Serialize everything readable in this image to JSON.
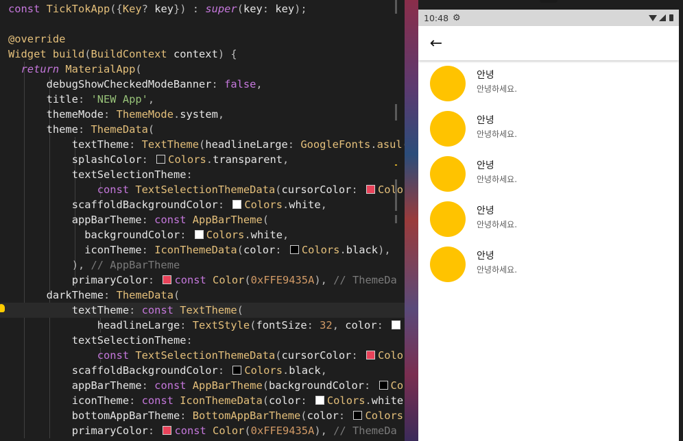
{
  "editor": {
    "lines": [
      [
        [
          "t-kw",
          "const "
        ],
        [
          "t-cls",
          "TickTokApp"
        ],
        [
          "t-pun",
          "({"
        ],
        [
          "t-cls",
          "Key"
        ],
        [
          "t-pun",
          "? "
        ],
        [
          "t-id",
          "key"
        ],
        [
          "t-pun",
          "}) : "
        ],
        [
          "t-kwi",
          "super"
        ],
        [
          "t-pun",
          "("
        ],
        [
          "t-id",
          "key"
        ],
        [
          "t-pun",
          ": "
        ],
        [
          "t-id",
          "key"
        ],
        [
          "t-pun",
          ");"
        ]
      ],
      [],
      [
        [
          "t-ann",
          "@override"
        ]
      ],
      [
        [
          "t-cls",
          "Widget "
        ],
        [
          "t-fn",
          "build"
        ],
        [
          "t-pun",
          "("
        ],
        [
          "t-cls",
          "BuildContext "
        ],
        [
          "t-id",
          "context"
        ],
        [
          "t-pun",
          ") {"
        ]
      ],
      [
        [
          "t-kwi",
          "return "
        ],
        [
          "t-cls",
          "MaterialApp"
        ],
        [
          "t-pun",
          "("
        ]
      ],
      [
        [
          "t-id",
          "debugShowCheckedModeBanner"
        ],
        [
          "t-pun",
          ": "
        ],
        [
          "t-kw",
          "false"
        ],
        [
          "t-pun",
          ","
        ]
      ],
      [
        [
          "t-id",
          "title"
        ],
        [
          "t-pun",
          ": "
        ],
        [
          "t-str",
          "'NEW App'"
        ],
        [
          "t-pun",
          ","
        ]
      ],
      [
        [
          "t-id",
          "themeMode"
        ],
        [
          "t-pun",
          ": "
        ],
        [
          "t-cls",
          "ThemeMode"
        ],
        [
          "t-pun",
          "."
        ],
        [
          "t-id",
          "system"
        ],
        [
          "t-pun",
          ","
        ]
      ],
      [
        [
          "t-id",
          "theme"
        ],
        [
          "t-pun",
          ": "
        ],
        [
          "t-cls",
          "ThemeData"
        ],
        [
          "t-pun",
          "("
        ]
      ],
      [
        [
          "t-id",
          "textTheme"
        ],
        [
          "t-pun",
          ": "
        ],
        [
          "t-cls",
          "TextTheme"
        ],
        [
          "t-pun",
          "("
        ],
        [
          "t-id",
          "headlineLarge"
        ],
        [
          "t-pun",
          ": "
        ],
        [
          "t-cls",
          "GoogleFonts"
        ],
        [
          "t-pun",
          "."
        ],
        [
          "t-fn",
          "asul("
        ]
      ],
      [
        [
          "t-id",
          "splashColor"
        ],
        [
          "t-pun",
          ": "
        ],
        [
          "sw",
          "transparent"
        ],
        [
          "t-cls",
          "Colors"
        ],
        [
          "t-pun",
          "."
        ],
        [
          "t-id",
          "transparent"
        ],
        [
          "t-pun",
          ","
        ]
      ],
      [
        [
          "t-id",
          "textSelectionTheme"
        ],
        [
          "t-pun",
          ":"
        ]
      ],
      [
        [
          "t-kw",
          "const "
        ],
        [
          "t-cls",
          "TextSelectionThemeData"
        ],
        [
          "t-pun",
          "("
        ],
        [
          "t-id",
          "cursorColor"
        ],
        [
          "t-pun",
          ": "
        ],
        [
          "sw",
          "pink"
        ],
        [
          "t-cls",
          "Colo"
        ]
      ],
      [
        [
          "t-id",
          "scaffoldBackgroundColor"
        ],
        [
          "t-pun",
          ": "
        ],
        [
          "sw",
          "white"
        ],
        [
          "t-cls",
          "Colors"
        ],
        [
          "t-pun",
          "."
        ],
        [
          "t-id",
          "white"
        ],
        [
          "t-pun",
          ","
        ]
      ],
      [
        [
          "t-id",
          "appBarTheme"
        ],
        [
          "t-pun",
          ": "
        ],
        [
          "t-kw",
          "const "
        ],
        [
          "t-cls",
          "AppBarTheme"
        ],
        [
          "t-pun",
          "("
        ]
      ],
      [
        [
          "t-id",
          "backgroundColor"
        ],
        [
          "t-pun",
          ": "
        ],
        [
          "sw",
          "white"
        ],
        [
          "t-cls",
          "Colors"
        ],
        [
          "t-pun",
          "."
        ],
        [
          "t-id",
          "white"
        ],
        [
          "t-pun",
          ","
        ]
      ],
      [
        [
          "t-id",
          "iconTheme"
        ],
        [
          "t-pun",
          ": "
        ],
        [
          "t-cls",
          "IconThemeData"
        ],
        [
          "t-pun",
          "("
        ],
        [
          "t-id",
          "color"
        ],
        [
          "t-pun",
          ": "
        ],
        [
          "sw",
          "black"
        ],
        [
          "t-cls",
          "Colors"
        ],
        [
          "t-pun",
          "."
        ],
        [
          "t-id",
          "black"
        ],
        [
          "t-pun",
          "),"
        ]
      ],
      [
        [
          "t-pun",
          "), "
        ],
        [
          "t-cmt",
          "// AppBarTheme"
        ]
      ],
      [
        [
          "t-id",
          "primaryColor"
        ],
        [
          "t-pun",
          ": "
        ],
        [
          "sw",
          "pink"
        ],
        [
          "t-kw",
          "const "
        ],
        [
          "t-cls",
          "Color"
        ],
        [
          "t-pun",
          "("
        ],
        [
          "t-num",
          "0xFFE9435A"
        ],
        [
          "t-pun",
          "), "
        ],
        [
          "t-cmt",
          "// ThemeDa"
        ]
      ],
      [
        [
          "t-id",
          "darkTheme"
        ],
        [
          "t-pun",
          ": "
        ],
        [
          "t-cls",
          "ThemeData"
        ],
        [
          "t-pun",
          "("
        ]
      ],
      [
        [
          "t-id",
          "textTheme"
        ],
        [
          "t-pun",
          ": "
        ],
        [
          "t-kw",
          "const "
        ],
        [
          "t-cls",
          "TextTheme"
        ],
        [
          "t-pun",
          "("
        ]
      ],
      [
        [
          "t-id",
          "headlineLarge"
        ],
        [
          "t-pun",
          ": "
        ],
        [
          "t-cls",
          "TextStyle"
        ],
        [
          "t-pun",
          "("
        ],
        [
          "t-id",
          "fontSize"
        ],
        [
          "t-pun",
          ": "
        ],
        [
          "t-num",
          "32"
        ],
        [
          "t-pun",
          ", "
        ],
        [
          "t-id",
          "color"
        ],
        [
          "t-pun",
          ": "
        ],
        [
          "sw",
          "white"
        ]
      ],
      [
        [
          "t-id",
          "textSelectionTheme"
        ],
        [
          "t-pun",
          ":"
        ]
      ],
      [
        [
          "t-kw",
          "const "
        ],
        [
          "t-cls",
          "TextSelectionThemeData"
        ],
        [
          "t-pun",
          "("
        ],
        [
          "t-id",
          "cursorColor"
        ],
        [
          "t-pun",
          ": "
        ],
        [
          "sw",
          "pink"
        ],
        [
          "t-cls",
          "Colo"
        ]
      ],
      [
        [
          "t-id",
          "scaffoldBackgroundColor"
        ],
        [
          "t-pun",
          ": "
        ],
        [
          "sw",
          "black"
        ],
        [
          "t-cls",
          "Colors"
        ],
        [
          "t-pun",
          "."
        ],
        [
          "t-id",
          "black"
        ],
        [
          "t-pun",
          ","
        ]
      ],
      [
        [
          "t-id",
          "appBarTheme"
        ],
        [
          "t-pun",
          ": "
        ],
        [
          "t-kw",
          "const "
        ],
        [
          "t-cls",
          "AppBarTheme"
        ],
        [
          "t-pun",
          "("
        ],
        [
          "t-id",
          "backgroundColor"
        ],
        [
          "t-pun",
          ": "
        ],
        [
          "sw",
          "black"
        ],
        [
          "t-cls",
          "Co"
        ]
      ],
      [
        [
          "t-id",
          "iconTheme"
        ],
        [
          "t-pun",
          ": "
        ],
        [
          "t-kw",
          "const "
        ],
        [
          "t-cls",
          "IconThemeData"
        ],
        [
          "t-pun",
          "("
        ],
        [
          "t-id",
          "color"
        ],
        [
          "t-pun",
          ": "
        ],
        [
          "sw",
          "white"
        ],
        [
          "t-cls",
          "Colors"
        ],
        [
          "t-pun",
          "."
        ],
        [
          "t-id",
          "white"
        ]
      ],
      [
        [
          "t-id",
          "bottomAppBarTheme"
        ],
        [
          "t-pun",
          ": "
        ],
        [
          "t-cls",
          "BottomAppBarTheme"
        ],
        [
          "t-pun",
          "("
        ],
        [
          "t-id",
          "color"
        ],
        [
          "t-pun",
          ": "
        ],
        [
          "sw",
          "black"
        ],
        [
          "t-cls",
          "Colors"
        ]
      ],
      [
        [
          "t-id",
          "primaryColor"
        ],
        [
          "t-pun",
          ": "
        ],
        [
          "sw",
          "pink"
        ],
        [
          "t-kw",
          "const "
        ],
        [
          "t-cls",
          "Color"
        ],
        [
          "t-pun",
          "("
        ],
        [
          "t-num",
          "0xFFE9435A"
        ],
        [
          "t-pun",
          "), "
        ],
        [
          "t-cmt",
          "// ThemeDa"
        ]
      ]
    ],
    "swatch_colors": {
      "transparent": "#1e1e1e",
      "pink": "#e9435a",
      "white": "#ffffff",
      "black": "#000000"
    }
  },
  "phone": {
    "status_time": "10:48",
    "status_settings_icon": "gear-icon",
    "back_icon": "arrow-back-icon",
    "back_glyph": "←",
    "avatar_color": "#ffc300",
    "items": [
      {
        "title": "안녕",
        "subtitle": "안녕하세요."
      },
      {
        "title": "안녕",
        "subtitle": "안녕하세요."
      },
      {
        "title": "안녕",
        "subtitle": "안녕하세요."
      },
      {
        "title": "안녕",
        "subtitle": "안녕하세요."
      },
      {
        "title": "안녕",
        "subtitle": "안녕하세요."
      }
    ]
  }
}
